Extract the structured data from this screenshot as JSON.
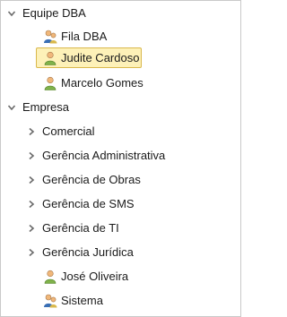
{
  "tree": {
    "groups": [
      {
        "label": "Equipe DBA",
        "expanded": true,
        "children": [
          {
            "label": "Fila DBA",
            "icon": "user-group-icon",
            "selected": false
          },
          {
            "label": "Judite Cardoso",
            "icon": "user-icon",
            "selected": true
          },
          {
            "label": "Marcelo Gomes",
            "icon": "user-icon",
            "selected": false
          }
        ]
      },
      {
        "label": "Empresa",
        "expanded": true,
        "children": [
          {
            "label": "Comercial",
            "type": "folder",
            "expanded": false
          },
          {
            "label": "Gerência Administrativa",
            "type": "folder",
            "expanded": false
          },
          {
            "label": "Gerência de Obras",
            "type": "folder",
            "expanded": false
          },
          {
            "label": "Gerência de SMS",
            "type": "folder",
            "expanded": false
          },
          {
            "label": "Gerência de TI",
            "type": "folder",
            "expanded": false
          },
          {
            "label": "Gerência Jurídica",
            "type": "folder",
            "expanded": false
          },
          {
            "label": "José Oliveira",
            "icon": "user-icon"
          },
          {
            "label": "Sistema",
            "icon": "user-group-icon"
          }
        ]
      }
    ]
  },
  "colors": {
    "selected_bg": "#fdf1b8",
    "selected_border": "#d9b84c",
    "user_icon_green": "#7fb24a",
    "user_icon_skin": "#f0b77a",
    "group_icon_blue": "#3a6fb5"
  }
}
